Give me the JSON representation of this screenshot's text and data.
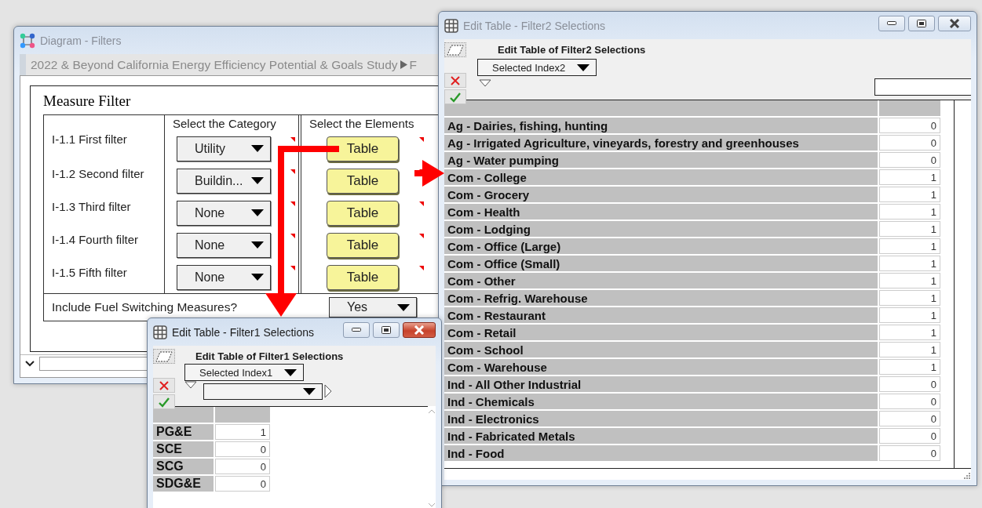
{
  "diagram_window": {
    "title": "Diagram - Filters",
    "active": false,
    "breadcrumb": [
      "2022 & Beyond California Energy Efficiency Potential & Goals Study",
      "F"
    ],
    "panel_title": "Measure Filter",
    "column_headers": [
      "Select the Category",
      "Select the Elements"
    ],
    "filters": [
      {
        "label": "I-1.1 First filter",
        "category": "Utility",
        "element_button": "Table"
      },
      {
        "label": "I-1.2 Second filter",
        "category": "Buildin...",
        "element_button": "Table"
      },
      {
        "label": "I-1.3 Third filter",
        "category": "None",
        "element_button": "Table"
      },
      {
        "label": "I-1.4 Fourth filter",
        "category": "None",
        "element_button": "Table"
      },
      {
        "label": "I-1.5 Fifth filter",
        "category": "None",
        "element_button": "Table"
      }
    ],
    "fuel_switching": {
      "label": "Include Fuel Switching Measures?",
      "value": "Yes"
    }
  },
  "filter2_window": {
    "title": "Edit Table - Filter2 Selections",
    "active": false,
    "heading": "Edit Table of Filter2 Selections",
    "index_selector": "Selected Index2",
    "rows": [
      {
        "label": "Ag - Dairies, fishing, hunting",
        "value": "0"
      },
      {
        "label": "Ag - Irrigated Agriculture, vineyards, forestry and greenhouses",
        "value": "0"
      },
      {
        "label": "Ag - Water pumping",
        "value": "0"
      },
      {
        "label": "Com - College",
        "value": "1"
      },
      {
        "label": "Com - Grocery",
        "value": "1"
      },
      {
        "label": "Com - Health",
        "value": "1"
      },
      {
        "label": "Com - Lodging",
        "value": "1"
      },
      {
        "label": "Com - Office (Large)",
        "value": "1"
      },
      {
        "label": "Com - Office (Small)",
        "value": "1"
      },
      {
        "label": "Com - Other",
        "value": "1"
      },
      {
        "label": "Com - Refrig. Warehouse",
        "value": "1"
      },
      {
        "label": "Com - Restaurant",
        "value": "1"
      },
      {
        "label": "Com - Retail",
        "value": "1"
      },
      {
        "label": "Com - School",
        "value": "1"
      },
      {
        "label": "Com - Warehouse",
        "value": "1"
      },
      {
        "label": "Ind - All Other Industrial",
        "value": "0"
      },
      {
        "label": "Ind - Chemicals",
        "value": "0"
      },
      {
        "label": "Ind - Electronics",
        "value": "0"
      },
      {
        "label": "Ind - Fabricated Metals",
        "value": "0"
      },
      {
        "label": "Ind - Food",
        "value": "0"
      }
    ]
  },
  "filter1_window": {
    "title": "Edit Table - Filter1 Selections",
    "active": true,
    "heading": "Edit Table of Filter1 Selections",
    "index_selector": "Selected Index1",
    "rows": [
      {
        "label": "PG&E",
        "value": "1"
      },
      {
        "label": "SCE",
        "value": "0"
      },
      {
        "label": "SCG",
        "value": "0"
      },
      {
        "label": "SDG&E",
        "value": "0"
      }
    ]
  }
}
